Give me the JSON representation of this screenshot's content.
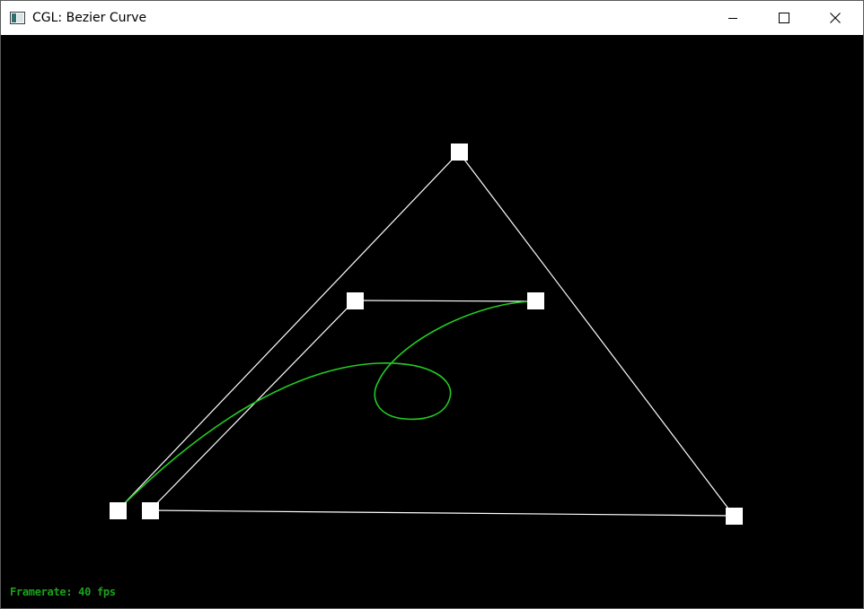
{
  "window": {
    "title": "CGL: Bezier Curve"
  },
  "titlebar_buttons": {
    "minimize_icon": "minimize-icon",
    "maximize_icon": "maximize-icon",
    "close_icon": "close-icon"
  },
  "scene": {
    "background_color": "#000000",
    "control_line_color": "#ffffff",
    "control_point_color": "#ffffff",
    "curve_color": "#22cc22"
  },
  "status": {
    "framerate": "Framerate: 40 fps"
  }
}
